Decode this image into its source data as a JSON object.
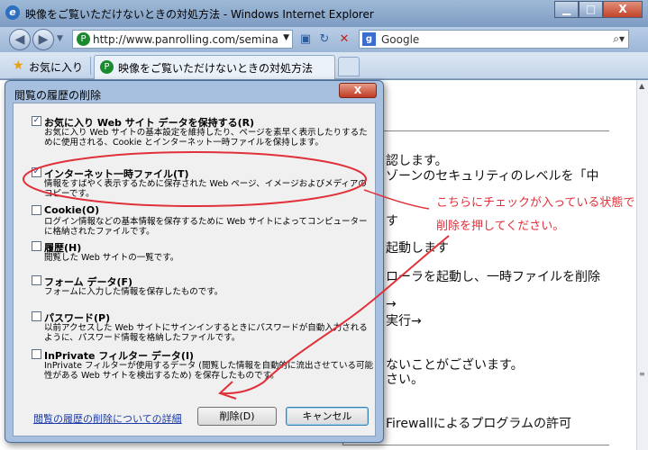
{
  "window": {
    "title": "映像をご覧いただけないときの対処方法 - Windows Internet Explorer",
    "controls": {
      "minimize": "▁",
      "maximize": "□",
      "close": "X"
    }
  },
  "navigation": {
    "address": "http://www.panrolling.com/seminar/hil",
    "search_provider": "Google"
  },
  "favorites_bar": {
    "favorites_label": "お気に入り",
    "tab_title": "映像をご覧いただけないときの対処方法"
  },
  "page": {
    "lines": [
      "認します。",
      "ゾーンのセキュリティのレベルを「中",
      "す",
      "起動します",
      "ローラを起動し、一時ファイルを削除",
      "→",
      "実行→",
      "ないことがございます。",
      "さい。",
      "Firewallによるプログラムの許可"
    ],
    "annotation_lines": [
      "こちらにチェックが入っている状態で",
      "削除を押してください。"
    ]
  },
  "dialog": {
    "title": "閲覧の履歴の削除",
    "close_label": "X",
    "options": [
      {
        "label": "お気に入り Web サイト データを保持する(R)",
        "checked": true,
        "description": "お気に入り Web サイトの基本設定を維持したり、ページを素早く表示したりするために使用される、Cookie とインターネット一時ファイルを保持します。"
      },
      {
        "label": "インターネット一時ファイル(T)",
        "checked": true,
        "description": "情報をすばやく表示するために保存された Web ページ、イメージおよびメディアのコピーです。"
      },
      {
        "label": "Cookie(O)",
        "checked": false,
        "description": "ログイン情報などの基本情報を保存するために Web サイトによってコンピューターに格納されたファイルです。"
      },
      {
        "label": "履歴(H)",
        "checked": false,
        "description": "閲覧した Web サイトの一覧です。"
      },
      {
        "label": "フォーム データ(F)",
        "checked": false,
        "description": "フォームに入力した情報を保存したものです。"
      },
      {
        "label": "パスワード(P)",
        "checked": false,
        "description": "以前アクセスした Web サイトにサインインするときにパスワードが自動入力されるように、パスワード情報を格納したファイルです。"
      },
      {
        "label": "InPrivate フィルター データ(I)",
        "checked": false,
        "description": "InPrivate フィルターが使用するデータ (閲覧した情報を自動的に流出させている可能性がある Web サイトを検出するため) を保存したものです。"
      }
    ],
    "details_link": "閲覧の履歴の削除についての詳細",
    "delete_button": "削除(D)",
    "cancel_button": "キャンセル"
  },
  "colors": {
    "annotation_red": "#e0303a",
    "link_blue": "#1a3aa8"
  }
}
